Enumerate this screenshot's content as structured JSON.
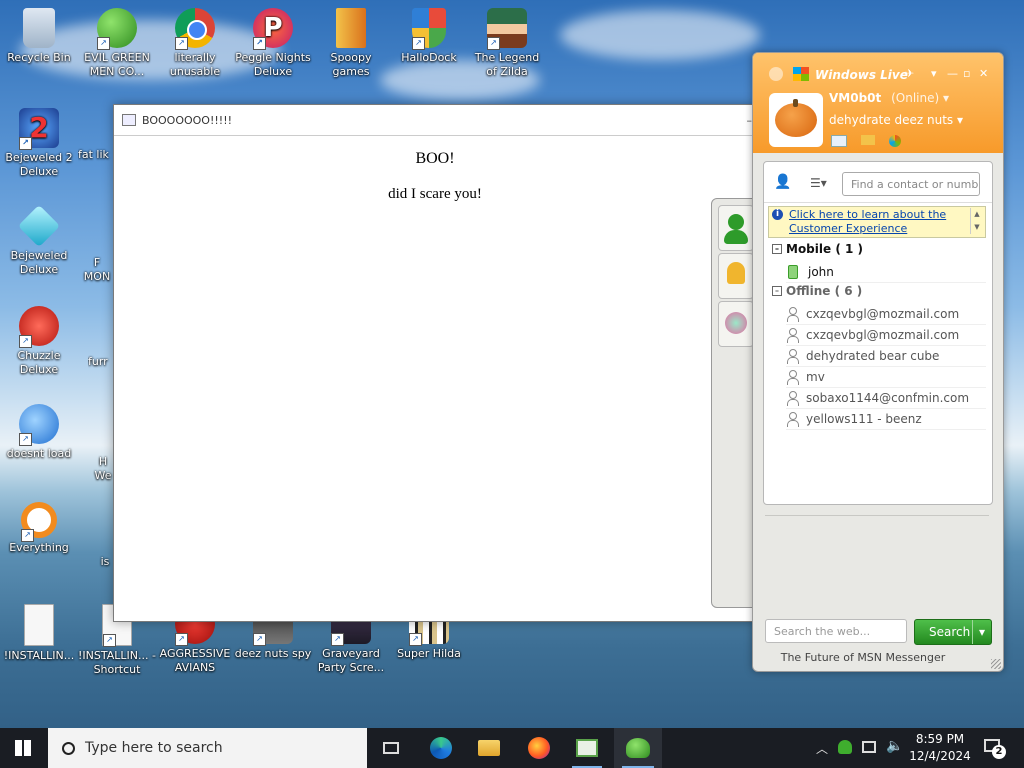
{
  "desktop": {
    "icons_top_row": [
      {
        "label": "Recycle Bin",
        "icon": "recycle-bin-icon"
      },
      {
        "label": "EVIL GREEN MEN CO...",
        "icon": "messenger-people-icon"
      },
      {
        "label": "literally unusable",
        "icon": "chrome-icon"
      },
      {
        "label": "Peggle Nights Deluxe",
        "icon": "peggle-icon"
      },
      {
        "label": "Spoopy games",
        "icon": "folder-icon"
      },
      {
        "label": "HalloDock",
        "icon": "shield-icon"
      },
      {
        "label": "The Legend of Zilda",
        "icon": "game-character-icon"
      }
    ],
    "icons_left_column": [
      {
        "label": "Bejeweled 2 Deluxe",
        "icon": "bejeweled2-icon"
      },
      {
        "label": "Bejeweled Deluxe",
        "icon": "diamond-icon"
      },
      {
        "label": "Chuzzle Deluxe",
        "icon": "chuzzle-icon"
      },
      {
        "label": "doesnt load",
        "icon": "thunderbird-icon"
      },
      {
        "label": "Everything",
        "icon": "magnifier-icon"
      }
    ],
    "icons_partial_column": [
      {
        "label": "fat lik"
      },
      {
        "label": "F MON"
      },
      {
        "label": "furr"
      },
      {
        "label": "H We"
      },
      {
        "label": "is"
      }
    ],
    "icons_bottom_row": [
      {
        "label": "!INSTALLIN...",
        "icon": "document-icon"
      },
      {
        "label": "!INSTALLIN... - Shortcut",
        "icon": "document-icon"
      },
      {
        "label": "AGGRESSIVE AVIANS",
        "icon": "angry-bird-icon"
      },
      {
        "label": "deez nuts spy",
        "icon": "spy-icon"
      },
      {
        "label": "Graveyard Party Scre...",
        "icon": "graveyard-icon"
      },
      {
        "label": "Super Hilda",
        "icon": "pixel-game-icon"
      }
    ]
  },
  "popup": {
    "title": "BOOOOOOO!!!!!",
    "heading": "BOO!",
    "message": "did I scare you!"
  },
  "messenger": {
    "brand": "Windows Live",
    "username": "VM0b0t",
    "status": "(Online)",
    "personal_message": "dehydrate deez nuts",
    "search_contacts_placeholder": "Find a contact or numbe",
    "info_link": "Click here to learn about the Customer Experience",
    "groups": [
      {
        "name": "Mobile ( 1 )",
        "contacts": [
          "john"
        ]
      },
      {
        "name": "Offline ( 6 )",
        "contacts": [
          "cxzqevbgl@mozmail.com",
          "cxzqevbgl@mozmail.com",
          "dehydrated bear cube",
          "mv",
          "sobaxo1144@confmin.com",
          "yellows111 - beenz"
        ]
      }
    ],
    "web_search_placeholder": "Search the web...",
    "search_button": "Search",
    "footer": "The Future of MSN Messenger"
  },
  "taskbar": {
    "search_placeholder": "Type here to search",
    "time": "8:59 PM",
    "date": "12/4/2024",
    "notification_count": "2"
  }
}
